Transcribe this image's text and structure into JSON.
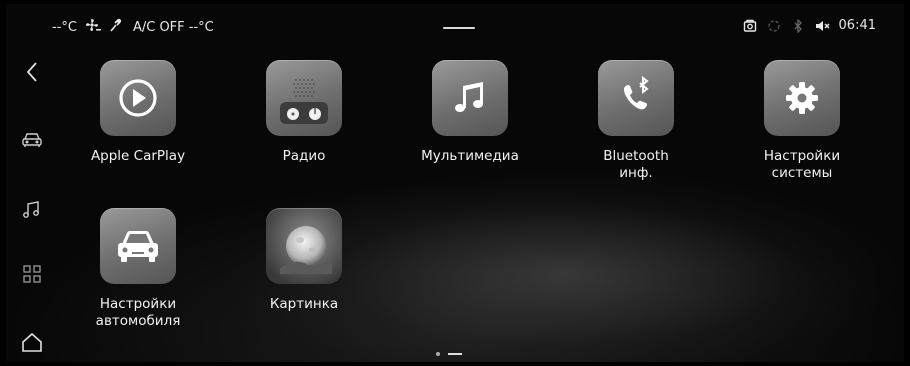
{
  "status": {
    "temp_left": "--°C",
    "ac": "A/C OFF --°C",
    "time": "06:41"
  },
  "sidebar": {
    "items": [
      {
        "name": "back",
        "icon": "chevron-left-icon"
      },
      {
        "name": "car",
        "icon": "car-icon"
      },
      {
        "name": "music",
        "icon": "music-note-icon"
      },
      {
        "name": "apps",
        "icon": "grid-icon"
      },
      {
        "name": "home",
        "icon": "home-icon"
      }
    ]
  },
  "apps": [
    {
      "label": "Apple CarPlay",
      "icon": "carplay-icon"
    },
    {
      "label": "Радио",
      "icon": "radio-icon"
    },
    {
      "label": "Мультимедиа",
      "icon": "music-icon"
    },
    {
      "label": "Bluetooth\nинф.",
      "icon": "bluetooth-phone-icon"
    },
    {
      "label": "Настройки\nсистемы",
      "icon": "settings-icon"
    },
    {
      "label": "Настройки\nавтомобиля",
      "icon": "car-settings-icon"
    },
    {
      "label": "Картинка",
      "icon": "picture-icon"
    }
  ],
  "pager": {
    "pages": 2,
    "current": 1
  }
}
